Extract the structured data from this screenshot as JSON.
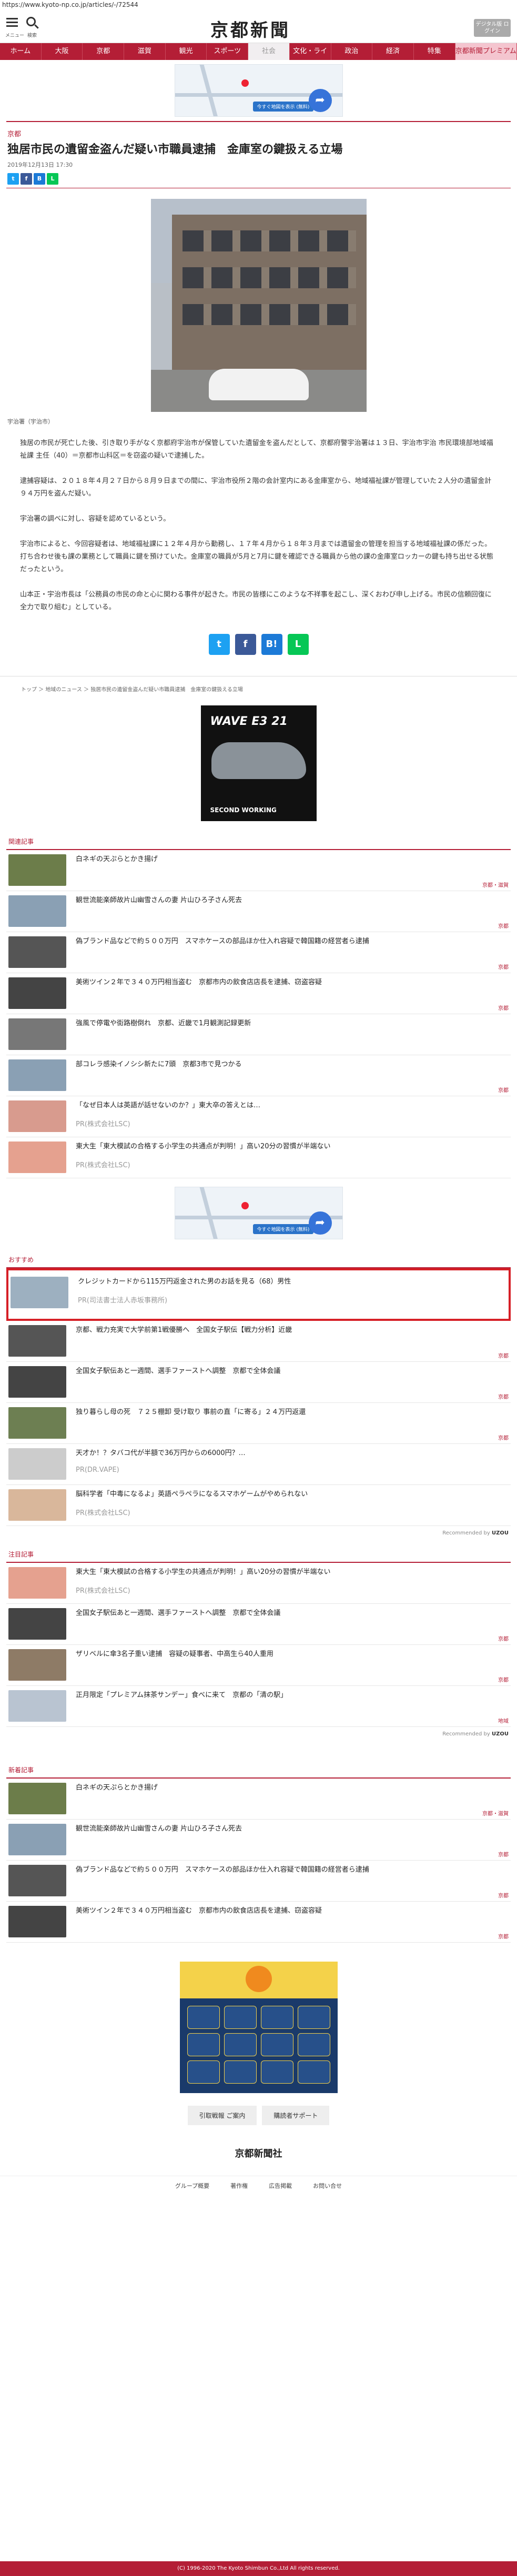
{
  "url": "https://www.kyoto-np.co.jp/articles/-/72544",
  "header": {
    "menu": "メニュー",
    "search": "検索",
    "logo": "京都新聞",
    "digital": "デジタル版\nログイン"
  },
  "nav": [
    "ホーム",
    "大阪",
    "京都",
    "滋賀",
    "観光",
    "スポーツ",
    "社会",
    "文化・ライフ",
    "政治",
    "経済",
    "特集",
    "京都新聞プレミアム"
  ],
  "ad": {
    "btn": "今すぐ地図を表示 (無料)"
  },
  "article": {
    "category": "京都",
    "title": "独居市民の遺留金盗んだ疑い市職員逮捕　金庫室の鍵扱える立場",
    "date": "2019年12月13日 17:30",
    "caption": "宇治署（宇治市）",
    "paras": [
      "独居の市民が死亡した後、引き取り手がなく京都府宇治市が保管していた遺留金を盗んだとして、京都府警宇治署は１３日、宇治市宇治 市民環境部地域福祉課 主任（40）＝京都市山科区＝を窃盗の疑いで逮捕した。",
      "逮捕容疑は、２０１８年４月２７日から８月９日までの間に、宇治市役所２階の会計室内にある金庫室から、地域福祉課が管理していた２人分の遺留金計９４万円を盗んだ疑い。",
      "宇治署の調べに対し、容疑を認めているという。",
      "宇治市によると、今回容疑者は、地域福祉課に１２年４月から勤務し、１７年４月から１８年３月までは遺留金の管理を担当する地域福祉課の係だった。打ち合わせ後も課の業務として職員に鍵を預けていた。金庫室の職員が5月と7月に鍵を確認できる職員から他の課の金庫室ロッカーの鍵も持ち出せる状態だったという。",
      "山本正・宇治市長は「公務員の市民の命と心に関わる事件が起きた。市民の皆様にこのような不祥事を起こし、深くおわび申し上げる。市民の信頼回復に全力で取り組む」としている。"
    ]
  },
  "breadcrumb": "トップ ＞ 地域のニュース ＞ 独居市民の遺留金盗んだ疑い市職員逮捕　金庫室の鍵扱える立場",
  "shoe": {
    "t1": "WAVE E3 21",
    "t2": "SECOND WORKING"
  },
  "related": {
    "title": "関連記事",
    "items": [
      {
        "t": "白ネギの天ぷらとかき揚げ",
        "tag": "京都・滋賀",
        "c": "#6c7d4a"
      },
      {
        "t": "観世流能楽師故片山幽雪さんの妻 片山ひろ子さん死去",
        "tag": "京都",
        "c": "#8aa0b4"
      },
      {
        "t": "偽ブランド品などで約５００万円　スマホケースの部品ほか仕入れ容疑で韓国籍の経営者ら逮捕",
        "tag": "京都",
        "c": "#555"
      },
      {
        "t": "美術ツイン２年で３４０万円相当盗む　京都市内の飲食店店長を逮捕、窃盗容疑",
        "tag": "京都",
        "c": "#444"
      },
      {
        "t": "強風で停電や街路樹倒れ　京都、近畿で1月観測記録更新",
        "tag": "",
        "c": "#777"
      },
      {
        "t": "部コレラ感染イノシシ新たに7頭　京都3市で見つかる",
        "tag": "京都",
        "c": "#8aa0b4"
      },
      {
        "t": "「なぜ日本人は英語が話せないのか？」東大卒の答えとは…",
        "tag": "",
        "pr": "PR(株式会社LSC)",
        "c": "#d89b8e"
      },
      {
        "t": "東大生「東大模試の合格する小学生の共通点が判明！」高い20分の習慣が半端ない",
        "tag": "",
        "pr": "PR(株式会社LSC)",
        "c": "#e5a18f"
      }
    ]
  },
  "recommend": {
    "title": "おすすめ",
    "items": [
      {
        "t": "クレジットカードから115万円返金された男のお話を見る（68）男性",
        "tag": "",
        "pr": "PR(司法書士法人赤坂事務所)",
        "c": "#9db0c0",
        "hl": true
      },
      {
        "t": "京都、戦力充実で大学前第1戦優勝へ　全国女子駅伝【戦力分析】近畿",
        "tag": "京都",
        "c": "#555"
      },
      {
        "t": "全国女子駅伝あと一週間、選手ファーストへ調整　京都で全体会議",
        "tag": "京都",
        "c": "#444"
      },
      {
        "t": "独り暮らし母の死　７２５棚卸 受け取り 事前の直「に寄る」２４万円返還 ",
        "tag": "京都",
        "c": "#6d7f52"
      },
      {
        "t": "天才か！？タバコ代が半額で36万円からの6000円？…",
        "tag": "",
        "pr": "PR(DR.VAPE)",
        "c": "#ccc"
      },
      {
        "t": "脳科学者「中毒になるよ」英語ペラペラになるスマホゲームがやめられない",
        "tag": "",
        "pr": "PR(株式会社LSC)",
        "c": "#d9b79b"
      }
    ],
    "by": "Recommended by"
  },
  "notable": {
    "title": "注目記事",
    "items": [
      {
        "t": "東大生「東大模試の合格する小学生の共通点が判明！」高い20分の習慣が半端ない",
        "tag": "",
        "pr": "PR(株式会社LSC)",
        "c": "#e5a18f"
      },
      {
        "t": "全国女子駅伝あと一週間、選手ファーストへ調整　京都で全体会議",
        "tag": "京都",
        "c": "#444"
      },
      {
        "t": "ザリベルに傘3名子重い逮捕　容疑の疑事者、中高生ら40人重用",
        "tag": "京都",
        "c": "#8e7b66"
      },
      {
        "t": "正月限定「プレミアム抹茶サンデー」食べに来て　京都の「清の駅」",
        "tag": "地域",
        "c": "#b9c4d1"
      }
    ],
    "by": "Recommended by"
  },
  "latest": {
    "title": "新着記事",
    "items": [
      {
        "t": "白ネギの天ぷらとかき揚げ",
        "tag": "京都・滋賀",
        "c": "#6c7d4a"
      },
      {
        "t": "観世流能楽師故片山幽雪さんの妻 片山ひろ子さん死去",
        "tag": "京都",
        "c": "#8aa0b4"
      },
      {
        "t": "偽ブランド品などで約５００万円　スマホケースの部品ほか仕入れ容疑で韓国籍の経営者ら逮捕",
        "tag": "京都",
        "c": "#555"
      },
      {
        "t": "美術ツイン２年で３４０万円相当盗む　京都市内の飲食店店長を逮捕、窃盗容疑",
        "tag": "京都",
        "c": "#444"
      }
    ]
  },
  "footer": {
    "btn1": "引取戦報 ご案内",
    "btn2": "購読者サポート",
    "logo": "京都新聞社",
    "links": [
      "グループ概要",
      "著作権",
      "広告掲載",
      "お問い合せ"
    ],
    "copy": "(C) 1996-2020 The Kyoto Shimbun Co.,Ltd All rights reserved."
  }
}
